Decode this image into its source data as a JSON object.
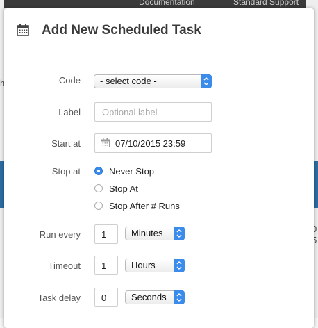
{
  "background": {
    "top_links": [
      "Documentation",
      "Standard Support"
    ],
    "fragments": {
      "left": "h",
      "right_1": "0",
      "right_2": "5"
    }
  },
  "modal": {
    "icon": "calendar-icon",
    "title": "Add New Scheduled Task"
  },
  "form": {
    "code": {
      "label": "Code",
      "selected": "- select code -"
    },
    "label_field": {
      "label": "Label",
      "placeholder": "Optional label",
      "value": ""
    },
    "start_at": {
      "label": "Start at",
      "value": "07/10/2015 23:59",
      "icon": "calendar-icon"
    },
    "stop_at": {
      "label": "Stop at",
      "options": [
        {
          "label": "Never Stop",
          "checked": true
        },
        {
          "label": "Stop At",
          "checked": false
        },
        {
          "label": "Stop After # Runs",
          "checked": false
        }
      ]
    },
    "run_every": {
      "label": "Run every",
      "value": "1",
      "unit": "Minutes"
    },
    "timeout": {
      "label": "Timeout",
      "value": "1",
      "unit": "Hours"
    },
    "task_delay": {
      "label": "Task delay",
      "value": "0",
      "unit": "Seconds"
    }
  },
  "colors": {
    "accent": "#3b8beb",
    "background_band": "#2d6ca2"
  }
}
